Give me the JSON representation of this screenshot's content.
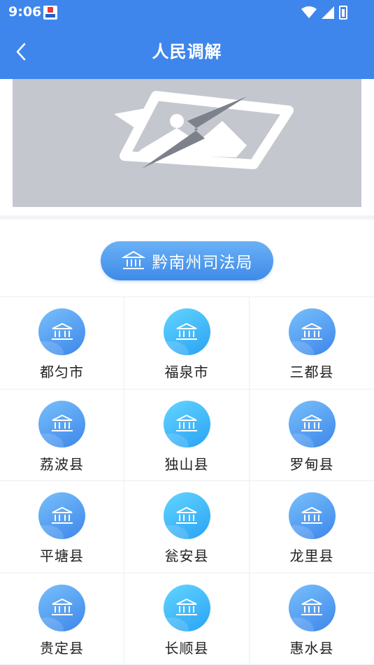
{
  "status_bar": {
    "time": "9:06"
  },
  "header": {
    "title": "人民调解"
  },
  "organization": {
    "label": "黔南州司法局"
  },
  "colors": {
    "primary": "#3f86ec",
    "banner_placeholder": "#c4c7ce"
  },
  "counties": [
    {
      "name": "都匀市",
      "icon": "courthouse-icon"
    },
    {
      "name": "福泉市",
      "icon": "courthouse-icon"
    },
    {
      "name": "三都县",
      "icon": "courthouse-icon"
    },
    {
      "name": "荔波县",
      "icon": "courthouse-icon"
    },
    {
      "name": "独山县",
      "icon": "courthouse-icon"
    },
    {
      "name": "罗甸县",
      "icon": "courthouse-icon"
    },
    {
      "name": "平塘县",
      "icon": "courthouse-icon"
    },
    {
      "name": "瓮安县",
      "icon": "courthouse-icon"
    },
    {
      "name": "龙里县",
      "icon": "courthouse-icon"
    },
    {
      "name": "贵定县",
      "icon": "courthouse-icon"
    },
    {
      "name": "长顺县",
      "icon": "courthouse-icon"
    },
    {
      "name": "惠水县",
      "icon": "courthouse-icon"
    }
  ]
}
